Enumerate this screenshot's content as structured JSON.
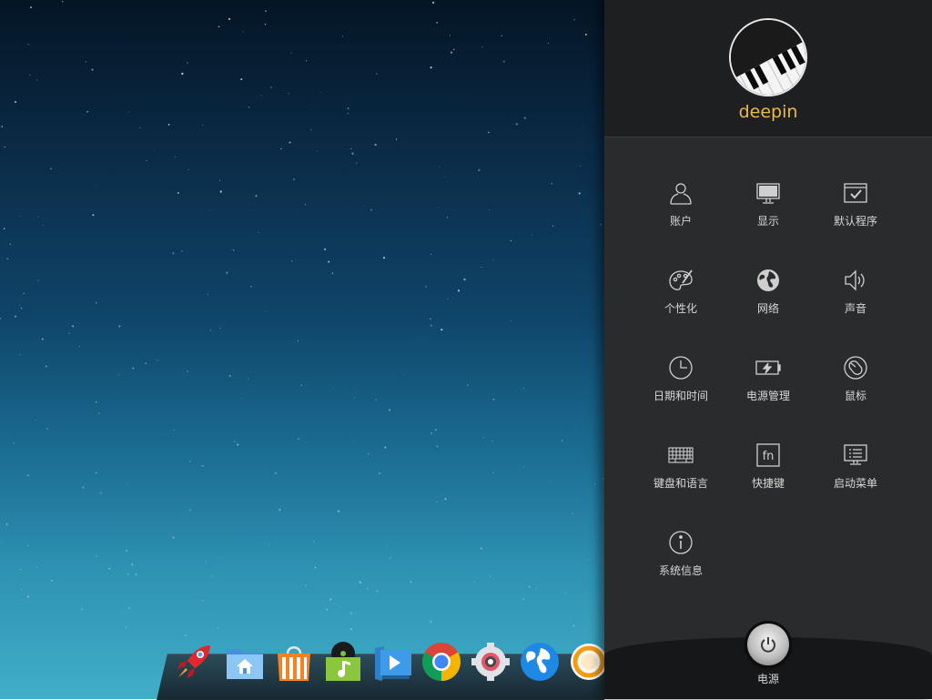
{
  "desktop": {
    "wallpaper": "starry-sky-gradient",
    "dock_items": [
      {
        "name": "launcher-icon",
        "app": "Launcher"
      },
      {
        "name": "file-manager-icon",
        "app": "File Manager"
      },
      {
        "name": "software-store-icon",
        "app": "Deepin Store"
      },
      {
        "name": "music-icon",
        "app": "Deepin Music"
      },
      {
        "name": "video-player-icon",
        "app": "Deepin Movie"
      },
      {
        "name": "chrome-icon",
        "app": "Google Chrome"
      },
      {
        "name": "settings-icon",
        "app": "System Settings"
      },
      {
        "name": "browser-globe-icon",
        "app": "Browser"
      },
      {
        "name": "app-icon-partial",
        "app": "Application"
      }
    ]
  },
  "control_center": {
    "username": "deepin",
    "accent_color": "#f0b93f",
    "modules": [
      {
        "label": "账户",
        "icon": "user-icon"
      },
      {
        "label": "显示",
        "icon": "monitor-icon"
      },
      {
        "label": "默认程序",
        "icon": "default-apps-icon"
      },
      {
        "label": "个性化",
        "icon": "palette-icon"
      },
      {
        "label": "网络",
        "icon": "globe-icon"
      },
      {
        "label": "声音",
        "icon": "speaker-icon"
      },
      {
        "label": "日期和时间",
        "icon": "clock-icon"
      },
      {
        "label": "电源管理",
        "icon": "battery-icon"
      },
      {
        "label": "鼠标",
        "icon": "mouse-icon"
      },
      {
        "label": "键盘和语言",
        "icon": "keyboard-icon"
      },
      {
        "label": "快捷键",
        "icon": "fn-key-icon"
      },
      {
        "label": "启动菜单",
        "icon": "boot-menu-icon"
      },
      {
        "label": "系统信息",
        "icon": "info-icon"
      }
    ],
    "power": {
      "label": "电源"
    }
  }
}
